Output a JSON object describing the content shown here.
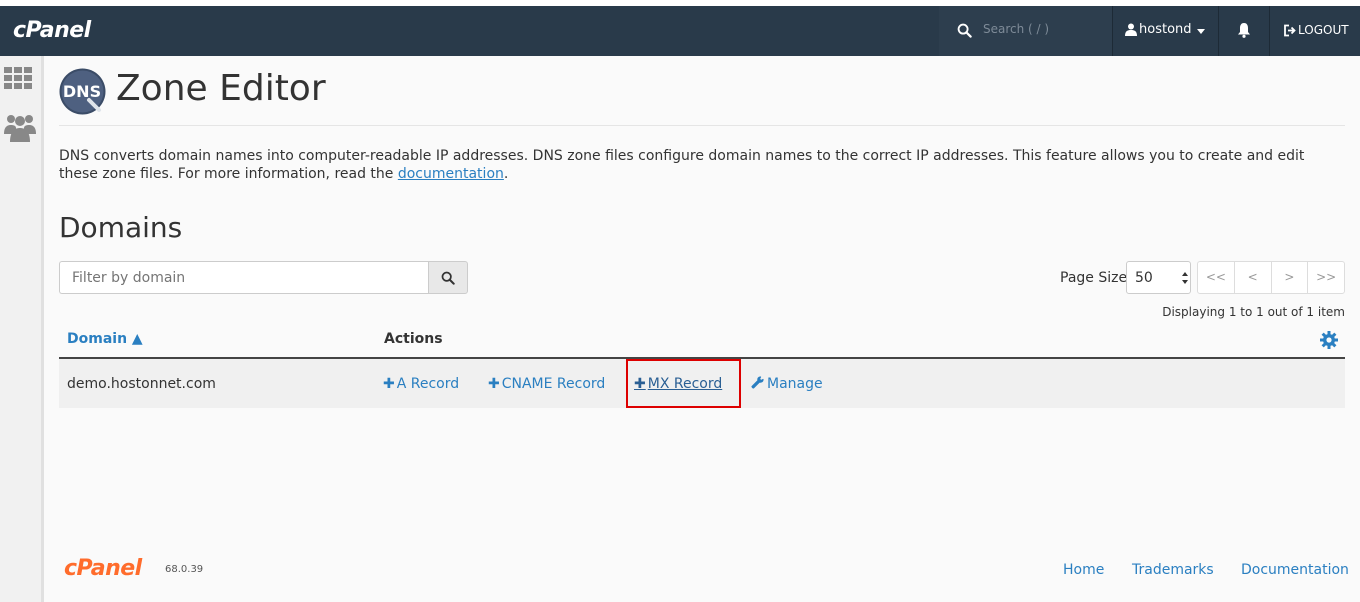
{
  "topbar": {
    "brand": "cPanel",
    "search_placeholder": "Search ( / )",
    "username": "hostond",
    "logout": "LOGOUT"
  },
  "header": {
    "badge": "DNS",
    "title": "Zone Editor"
  },
  "description": {
    "text": "DNS converts domain names into computer-readable IP addresses. DNS zone files configure domain names to the correct IP addresses. This feature allows you to create and edit these zone files. For more information, read the ",
    "link": "documentation",
    "end": "."
  },
  "domains": {
    "title": "Domains",
    "filter_placeholder": "Filter by domain",
    "page_size_label": "Page Size",
    "page_size_value": "50",
    "pager": [
      "<<",
      "<",
      ">",
      ">>"
    ],
    "displaying": "Displaying 1 to 1 out of 1 item",
    "col_domain": "Domain",
    "col_domain_sort": "▲",
    "col_actions": "Actions",
    "rows": [
      {
        "domain": "demo.hostonnet.com",
        "actions": {
          "a_record": "A Record",
          "cname_record": "CNAME Record",
          "mx_record": "MX Record",
          "manage": "Manage"
        }
      }
    ]
  },
  "footer": {
    "brand": "cPanel",
    "version": "68.0.39",
    "links": [
      "Home",
      "Trademarks",
      "Documentation"
    ]
  },
  "colors": {
    "topbar": "#293a4a",
    "link": "#2a7fc1",
    "highlight": "#dd0000",
    "footer_brand": "#ff6c2c"
  }
}
